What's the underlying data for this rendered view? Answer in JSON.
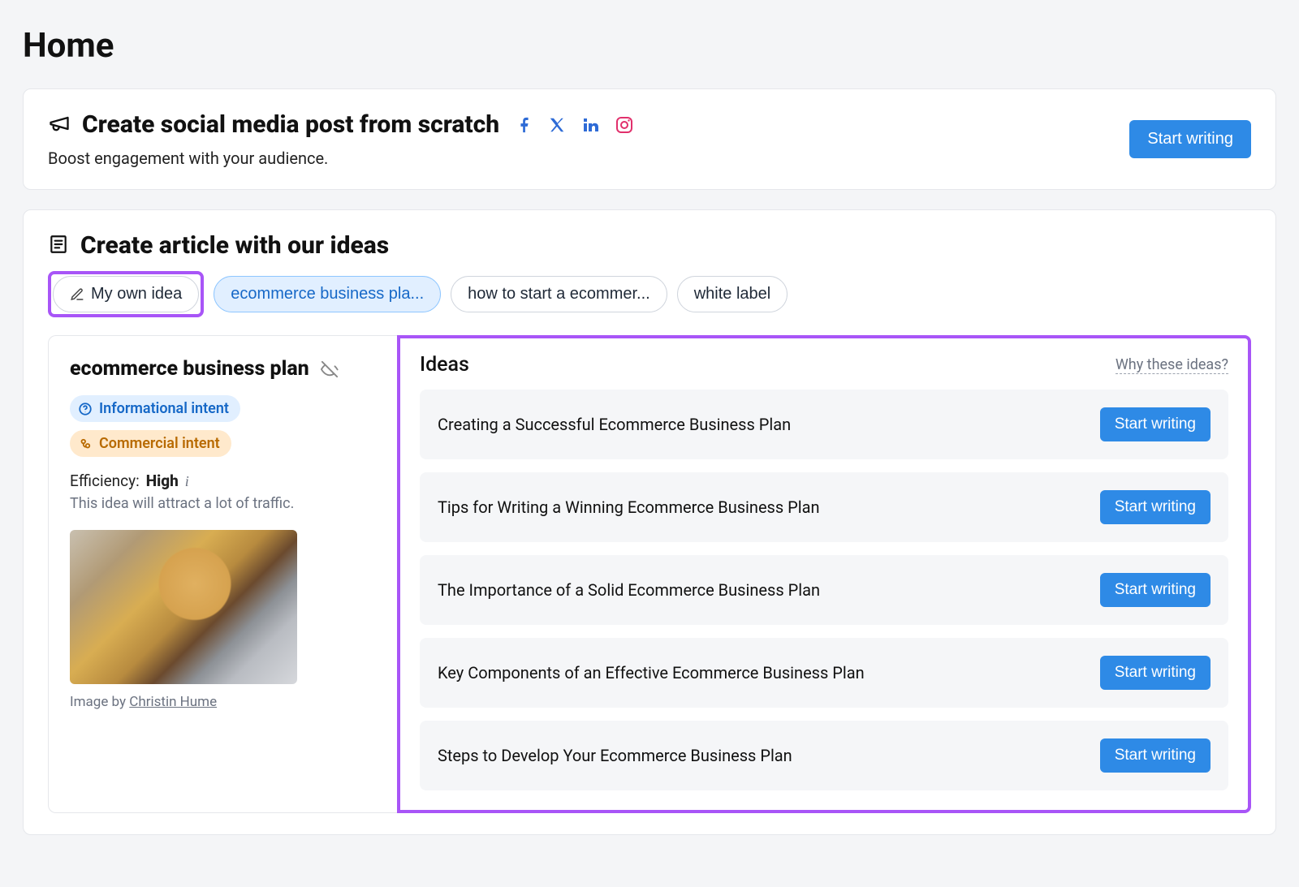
{
  "page": {
    "title": "Home"
  },
  "social_card": {
    "title": "Create social media post from scratch",
    "subtitle": "Boost engagement with your audience.",
    "icons": [
      "facebook",
      "x",
      "linkedin",
      "instagram"
    ],
    "cta": "Start writing"
  },
  "article_card": {
    "title": "Create article with our ideas",
    "chips": {
      "own": "My own idea",
      "items": [
        {
          "label": "ecommerce business pla...",
          "active": true
        },
        {
          "label": "how to start a ecommer...",
          "active": false
        },
        {
          "label": "white label",
          "active": false
        }
      ]
    },
    "detail": {
      "topic": "ecommerce business plan",
      "intents": {
        "informational": "Informational intent",
        "commercial": "Commercial intent"
      },
      "efficiency_label": "Efficiency:",
      "efficiency_value": "High",
      "efficiency_desc": "This idea will attract a lot of traffic.",
      "image_byline_prefix": "Image by ",
      "image_author": "Christin Hume"
    },
    "ideas": {
      "heading": "Ideas",
      "why_link": "Why these ideas?",
      "cta": "Start writing",
      "items": [
        "Creating a Successful Ecommerce Business Plan",
        "Tips for Writing a Winning Ecommerce Business Plan",
        "The Importance of a Solid Ecommerce Business Plan",
        "Key Components of an Effective Ecommerce Business Plan",
        "Steps to Develop Your Ecommerce Business Plan"
      ]
    }
  }
}
